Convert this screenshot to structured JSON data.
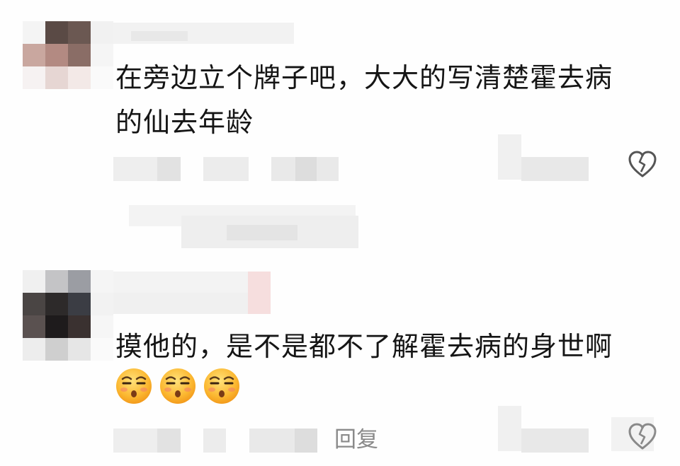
{
  "comments": [
    {
      "text_line1": "在旁边立个牌子吧，大大的写清楚霍去病",
      "text_line2": "的仙去年龄",
      "avatar_colors": [
        "#f4f4f4",
        "#5a4a45",
        "#6b5852",
        "#f1f1f1",
        "#c9a79f",
        "#b38a82",
        "#8a6d66",
        "#f5f5f5",
        "#f6f2f2",
        "#e6d6d3",
        "#f3e9e7",
        "#fafafa"
      ],
      "dislike_icon": "broken-heart-icon"
    },
    {
      "text_line1": "摸他的，是不是都不了解霍去病的身世啊",
      "emoji": [
        "smug-face-emoji",
        "smug-face-emoji",
        "smug-face-emoji"
      ],
      "avatar_colors": [
        "#f0f0f0",
        "#c4c4c6",
        "#9b9da3",
        "#f5f5f5",
        "#4a4544",
        "#2d2a2a",
        "#3b3d44",
        "#f2f2f2",
        "#5a5150",
        "#1e1b1c",
        "#3a3130",
        "#f6f6f6",
        "#ededed",
        "#cfcfcf",
        "#e6e6e6",
        "#fafafa"
      ],
      "reply_label": "回复",
      "dislike_icon": "broken-heart-icon"
    }
  ]
}
